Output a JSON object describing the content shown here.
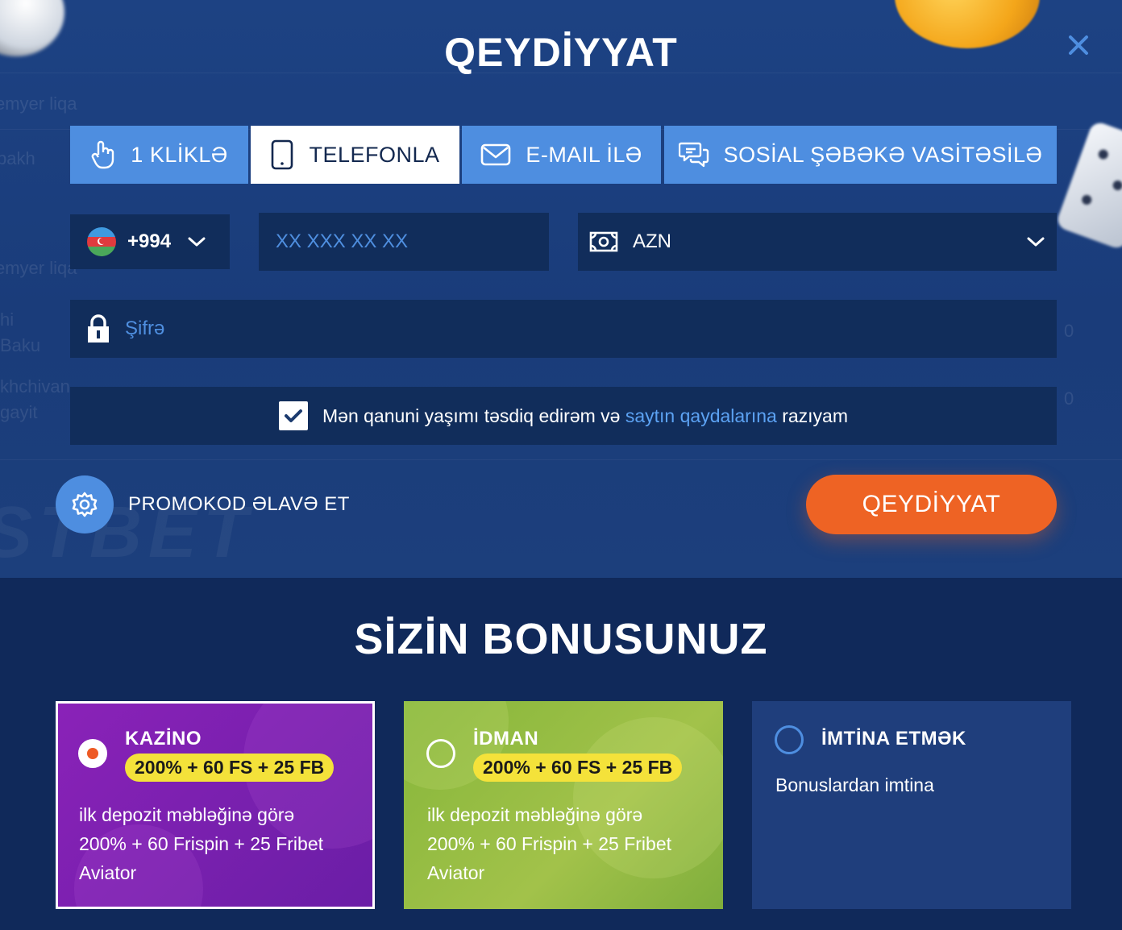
{
  "modal": {
    "title": "QEYDİYYAT",
    "close_icon": "close-icon"
  },
  "tabs": [
    {
      "label": "1 KLİKLƏ",
      "icon": "hand-pointer-icon",
      "active": false
    },
    {
      "label": "TELEFONLA",
      "icon": "tablet-icon",
      "active": true
    },
    {
      "label": "E-MAIL İLƏ",
      "icon": "envelope-icon",
      "active": false
    },
    {
      "label": "SOSİAL ŞƏBƏKƏ VASİTƏSİLƏ",
      "icon": "chat-bubbles-icon",
      "active": false
    }
  ],
  "form": {
    "country_code": "+994",
    "phone_placeholder": "XX XXX XX XX",
    "currency": "AZN",
    "password_placeholder": "Şifrə",
    "agree_checked": true,
    "agree_text_before": "Mən qanuni yaşımı təsdiq edirəm və ",
    "agree_link": "saytın qaydalarına",
    "agree_text_after": " razıyam",
    "promo_label": "PROMOKOD ƏLAVƏ ET",
    "submit_label": "QEYDİYYAT"
  },
  "background_text": {
    "row1": "emyer liqa",
    "row2": "bakh",
    "row3": "emyer liqa",
    "row4a": "hi",
    "row4b": "Baku",
    "row5a": "khchivan",
    "row5b": "gayit",
    "zero1": "0",
    "zero2": "0"
  },
  "bonus": {
    "title": "SİZİN BONUSUNUZ",
    "cards": [
      {
        "title": "KAZİNO",
        "badge": "200% + 60 FS + 25 FB",
        "line1": "ilk depozit məbləğinə görə",
        "line2": "200% + 60 Frispin + 25 Fribet",
        "line3": "Aviator",
        "selected": true
      },
      {
        "title": "İDMAN",
        "badge": "200% + 60 FS + 25 FB",
        "line1": "ilk depozit məbləğinə görə",
        "line2": "200% + 60 Frispin + 25 Fribet",
        "line3": "Aviator",
        "selected": false
      },
      {
        "title": "İMTİNA ETMƏK",
        "line1": "Bonuslardan imtina",
        "selected": false
      }
    ]
  },
  "colors": {
    "primary_blue": "#4e8ee0",
    "field_bg": "#112d5b",
    "accent_orange": "#ee6324",
    "badge_yellow": "#f4e23a"
  }
}
